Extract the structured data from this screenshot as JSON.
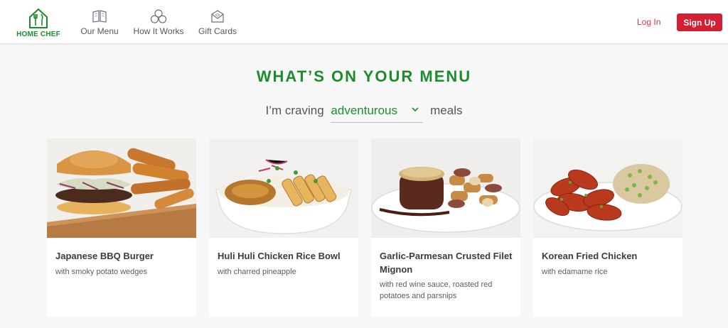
{
  "header": {
    "logo_text": "HOME CHEF",
    "nav": [
      {
        "label": "Our Menu",
        "icon": "book-icon"
      },
      {
        "label": "How It Works",
        "icon": "circles-icon"
      },
      {
        "label": "Gift Cards",
        "icon": "envelope-icon"
      }
    ],
    "login_label": "Log In",
    "signup_label": "Sign Up"
  },
  "hero": {
    "headline": "WHAT’S ON YOUR MENU",
    "prefix": "I’m craving",
    "selected": "adventurous",
    "suffix": "meals"
  },
  "meals": [
    {
      "title": "Japanese BBQ Burger",
      "subtitle": "with smoky potato wedges"
    },
    {
      "title": "Huli Huli Chicken Rice Bowl",
      "subtitle": "with charred pineapple"
    },
    {
      "title": "Garlic-Parmesan Crusted Filet Mignon",
      "subtitle": "with red wine sauce, roasted red potatoes and parsnips"
    },
    {
      "title": "Korean Fried Chicken",
      "subtitle": "with edamame rice"
    }
  ],
  "colors": {
    "brand_green": "#1e8c2e",
    "signup_red": "#d21f32",
    "login_red": "#d9363e"
  }
}
